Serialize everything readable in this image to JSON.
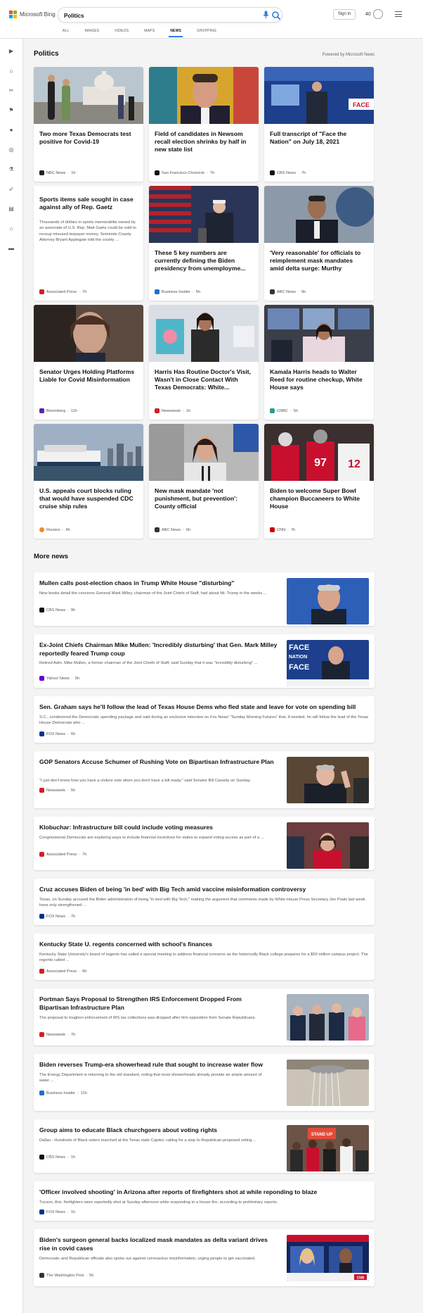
{
  "header": {
    "logo_text": "Microsoft Bing",
    "search_value": "Politics",
    "sign_in": "Sign in",
    "rewards_count": "40"
  },
  "tabs": [
    "ALL",
    "IMAGES",
    "VIDEOS",
    "MAPS",
    "NEWS",
    "SHOPPING"
  ],
  "active_tab": "NEWS",
  "section": {
    "title": "Politics",
    "powered_by": "Powered by Microsoft News"
  },
  "cards": [
    {
      "title": "Two more Texas Democrats test positive for Covid-19",
      "source": "NBC News",
      "age": "1h",
      "badge_color": "#222"
    },
    {
      "title": "Field of candidates in Newsom recall election shrinks by half in new state list",
      "source": "San Francisco Chronicle",
      "age": "7h",
      "badge_color": "#111"
    },
    {
      "title": "Full transcript of \"Face the Nation\" on July 18, 2021",
      "source": "CBS News",
      "age": "7h",
      "badge_color": "#111"
    },
    {
      "title": "Sports items sale sought in case against ally of Rep. Gaetz",
      "snippet": "Thousands of dollars in sports memorabilia owned by an associate of U.S. Rep. Matt Gaetz could be sold to recoup misused taxpayer money. Seminole County Attorney Bryant Applegate told the county ...",
      "source": "Associated Press",
      "age": "7h",
      "badge_color": "#d21f26"
    },
    {
      "title": "These 5 key numbers are currently defining the Biden presidency from unemployme...",
      "source": "Business Insider",
      "age": "5h",
      "badge_color": "#1f6fd1"
    },
    {
      "title": "'Very reasonable' for officials to reimplement mask mandates amid delta surge: Murthy",
      "source": "ABC News",
      "age": "9h",
      "badge_color": "#333"
    },
    {
      "title": "Senator Urges Holding Platforms Liable for Covid Misinformation",
      "source": "Bloomberg",
      "age": "11h",
      "badge_color": "#5b21b6"
    },
    {
      "title": "Harris Has Routine Doctor's Visit, Wasn't in Close Contact With Texas Democrats: White...",
      "source": "Newsweek",
      "age": "1h",
      "badge_color": "#d21f26"
    },
    {
      "title": "Kamala Harris heads to Walter Reed for routine checkup, White House says",
      "source": "CNBC",
      "age": "5h",
      "badge_color": "#2a9d8f"
    },
    {
      "title": "U.S. appeals court blocks ruling that would have suspended CDC cruise ship rules",
      "source": "Reuters",
      "age": "4h",
      "badge_color": "#f08a24"
    },
    {
      "title": "New mask mandate 'not punishment, but prevention': County official",
      "source": "ABC News",
      "age": "6h",
      "badge_color": "#333"
    },
    {
      "title": "Biden to welcome Super Bowl champion Buccaneers to White House",
      "source": "CNN",
      "age": "7h",
      "badge_color": "#cc0000"
    }
  ],
  "more_news_title": "More news",
  "news": [
    {
      "title": "Mullen calls post-election chaos in Trump White House \"disturbing\"",
      "snippet": "New books detail the concerns General Mark Milley, chairman of the Joint Chiefs of Staff, had about Mr. Trump in the weeks ...",
      "source": "CBS News",
      "age": "9h",
      "badge_color": "#111",
      "thumb": true
    },
    {
      "title": "Ex-Joint Chiefs Chairman Mike Mullen: 'Incredibly disturbing' that Gen. Mark Milley reportedly feared Trump coup",
      "snippet": "Retired Adm. Mike Mullen, a former chairman of the Joint Chiefs of Staff, said Sunday that it was \"incredibly disturbing\" ...",
      "source": "Yahoo! News",
      "age": "9h",
      "badge_color": "#6001d2",
      "thumb": true
    },
    {
      "title": "Sen. Graham says he'll follow the lead of Texas House Dems who fled state and leave for vote on spending bill",
      "snippet": "S.C., condemned the Democratic spending package and said during an exclusive interview on Fox News' \"Sunday Morning Futures\" that, if needed, he will follow the lead of the Texas House Democrats who ...",
      "source": "FOX News",
      "age": "6h",
      "badge_color": "#00338d",
      "thumb": false
    },
    {
      "title": "GOP Senators Accuse Schumer of Rushing Vote on Bipartisan Infrastructure Plan",
      "snippet": "\"I just don't know how you have a cloture vote when you don't have a bill ready,\" said Senator Bill Cassidy on Sunday.",
      "source": "Newsweek",
      "age": "5h",
      "badge_color": "#d21f26",
      "thumb": true
    },
    {
      "title": "Klobuchar: Infrastructure bill could include voting measures",
      "snippet": "Congressional Democrats are exploring ways to include financial incentives for states to expand voting access as part of a ...",
      "source": "Associated Press",
      "age": "7h",
      "badge_color": "#d21f26",
      "thumb": true
    },
    {
      "title": "Cruz accuses Biden of being 'in bed' with Big Tech amid vaccine misinformation controversy",
      "snippet": "Texas, on Sunday accused the Biden administration of being \"in bed with Big Tech,\" making the argument that comments made by White House Press Secretary Jen Psaki last week have only strengthened ...",
      "source": "FOX News",
      "age": "7h",
      "badge_color": "#00338d",
      "thumb": false
    },
    {
      "title": "Kentucky State U. regents concerned with school's finances",
      "snippet": "Kentucky State University's board of regents has called a special meeting to address financial concerns as the historically Black college prepares for a $50 million campus project. The regents called ...",
      "source": "Associated Press",
      "age": "6h",
      "badge_color": "#d21f26",
      "thumb": false
    },
    {
      "title": "Portman Says Proposal to Strengthen IRS Enforcement Dropped From Bipartisan Infrastructure Plan",
      "snippet": "The proposal to toughen enforcement of IRS tax collections was dropped after firm opposition from Senate Republicans.",
      "source": "Newsweek",
      "age": "7h",
      "badge_color": "#d21f26",
      "thumb": true
    },
    {
      "title": "Biden reverses Trump-era showerhead rule that sought to increase water flow",
      "snippet": "The Energy Department is returning to the old standard, noting that most showerheads already provide an ample amount of water ...",
      "source": "Business Insider",
      "age": "11h",
      "badge_color": "#1f6fd1",
      "thumb": true
    },
    {
      "title": "Group aims to educate Black churchgoers about voting rights",
      "snippet": "Dallas - Hundreds of Black voters marched at the Texas state Capitol, calling for a stop to Republican-proposed voting ...",
      "source": "CBS News",
      "age": "1h",
      "badge_color": "#111",
      "thumb": true
    },
    {
      "title": "'Officer involved shooting' in Arizona after reports of firefighters shot at while reponding to blaze",
      "snippet": "Tucson, Ariz. firefighters were reportedly shot at Sunday afternoon while responding to a house fire, according to preliminary reports.",
      "source": "FOX News",
      "age": "1h",
      "badge_color": "#00338d",
      "thumb": false
    },
    {
      "title": "Biden's surgeon general backs localized mask mandates as delta variant drives rise in covid cases",
      "snippet": "Democratic and Republican officials also spoke out against coronavirus misinformation, urging people to get vaccinated.",
      "source": "The Washington Post",
      "age": "5h",
      "badge_color": "#333",
      "thumb": true
    }
  ],
  "thumb_labels": {
    "face_nation": "FACE",
    "nation": "NATION",
    "cnn": "CNN",
    "protest_sign": "STAND UP"
  }
}
